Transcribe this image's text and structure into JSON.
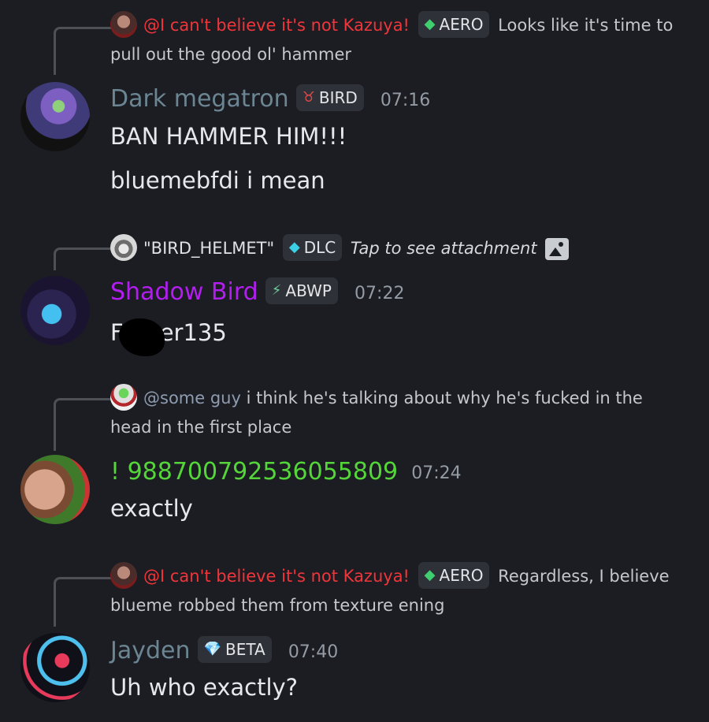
{
  "messages": [
    {
      "reply": {
        "author": "@I can't believe it's not Kazuya!",
        "tag": "AERO",
        "text": "Looks like it's time to pull out the good ol' hammer"
      },
      "author": {
        "name": "Dark megatron",
        "color": "#6b8592"
      },
      "tag": "BIRD",
      "time": "07:16",
      "lines": [
        "BAN HAMMER HIM!!!",
        "bluemebfdi i mean"
      ]
    },
    {
      "reply": {
        "author": "\"BIRD_HELMET\"",
        "tag": "DLC",
        "text": "Tap to see attachment"
      },
      "author": {
        "name": "Shadow Bird",
        "color": "#b31ef0"
      },
      "tag": "ABWP",
      "time": "07:22",
      "lines_parts": {
        "start": "F",
        "end": "er135"
      }
    },
    {
      "reply": {
        "author": "@some guy",
        "text": "i think he's talking about why he's fucked in the head in the first place"
      },
      "author": {
        "name": "! 988700792536055809",
        "color": "#54d63a"
      },
      "time": "07:24",
      "lines": [
        "exactly"
      ]
    },
    {
      "reply": {
        "author": "@I can't believe it's not Kazuya!",
        "tag": "AERO",
        "text": "Regardless, I believe blueme robbed them from texture ening"
      },
      "author": {
        "name": "Jayden",
        "color": "#6b8592"
      },
      "tag": "BETA",
      "time": "07:40",
      "lines": [
        "Uh who exactly?"
      ]
    }
  ],
  "colors": {
    "background": "#1c1d22",
    "mention_red": "#f0353a",
    "timestamp": "#949ba4"
  },
  "icons": {
    "aero": "green-leaf-icon",
    "bird": "red-bull-icon",
    "dlc": "cyan-leaf-icon",
    "abwp": "lightning-icon",
    "beta": "diamond-icon",
    "attachment": "image-icon"
  }
}
